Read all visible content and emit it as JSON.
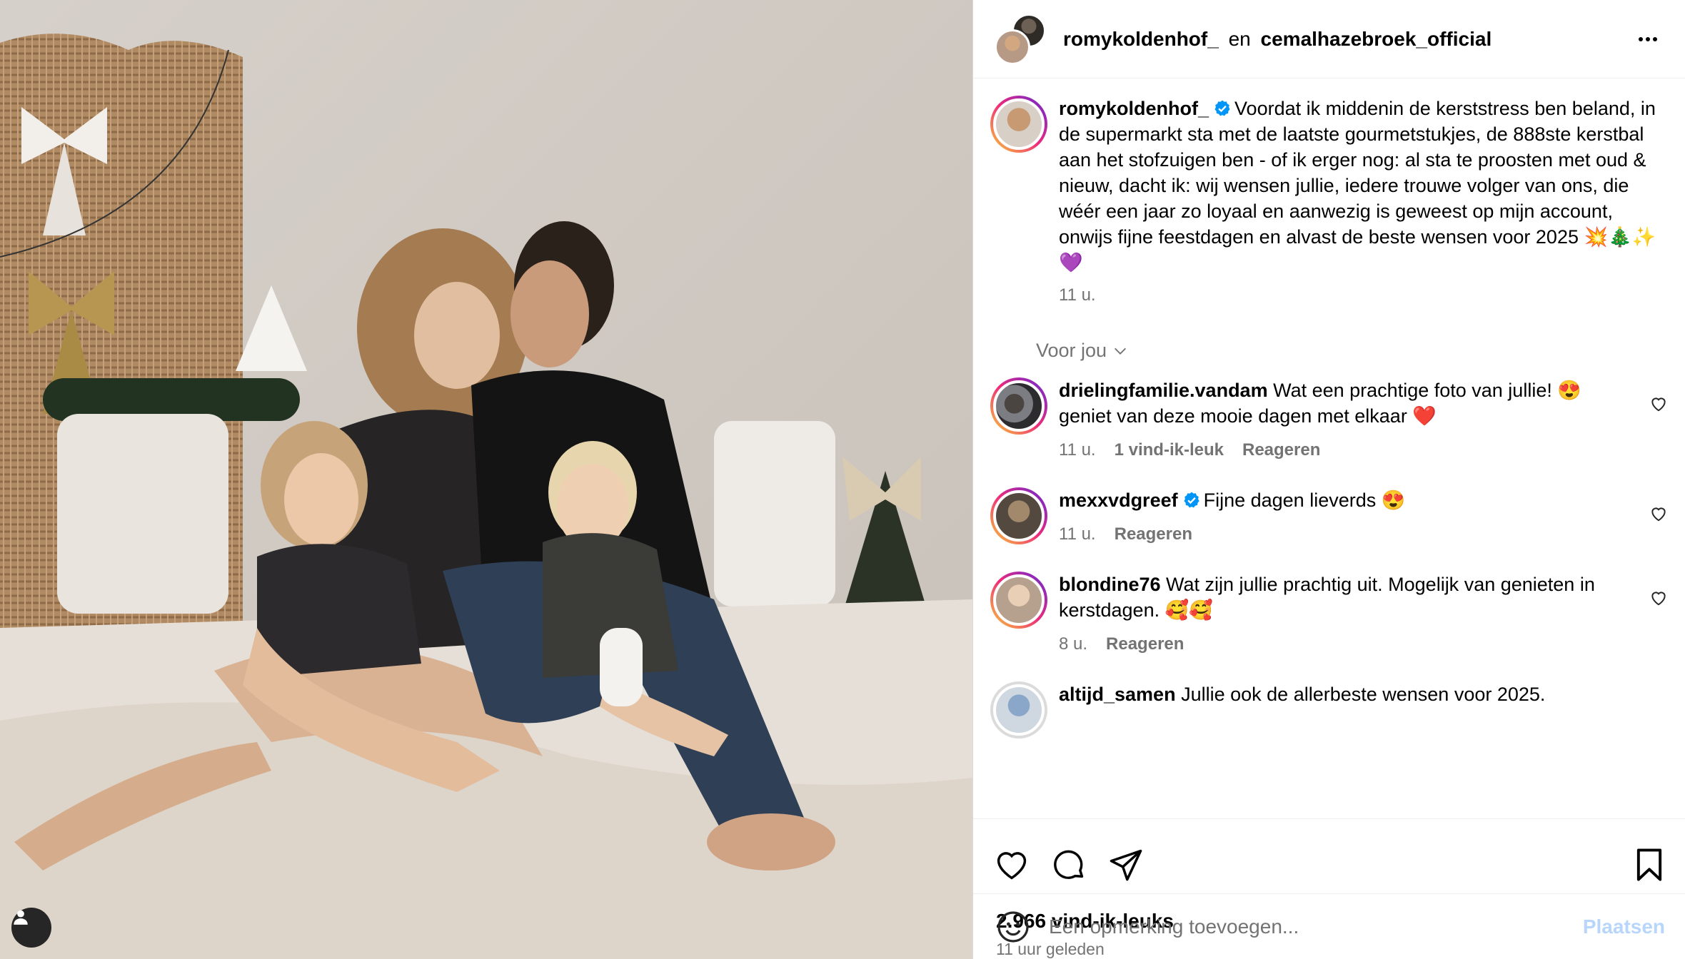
{
  "header": {
    "user1": "romykoldenhof_",
    "conjunction": "en",
    "user2": "cemalhazebroek_official"
  },
  "caption": {
    "username": "romykoldenhof_",
    "text": "Voordat ik middenin de kerststress ben beland, in de supermarkt sta met de laatste gourmetstukjes, de 888ste kerstbal aan het stofzuigen ben - of ik erger nog: al sta te proosten met oud & nieuw, dacht ik: wij wensen jullie, iedere trouwe volger van ons, die wéér een jaar zo loyaal en aanwezig is geweest op mijn account, onwijs fijne feestdagen en alvast de beste wensen voor 2025 💥🎄✨💜",
    "time": "11 u."
  },
  "for_you_label": "Voor jou",
  "comments": [
    {
      "username": "drielingfamilie.vandam",
      "text": "Wat een prachtige foto van jullie! 😍 geniet van deze mooie dagen met elkaar ❤️",
      "time": "11 u.",
      "likes": "1 vind-ik-leuk",
      "reply": "Reageren"
    },
    {
      "username": "mexxvdgreef",
      "text": "Fijne dagen lieverds 😍",
      "time": "11 u.",
      "reply": "Reageren"
    },
    {
      "username": "blondine76",
      "text": "Wat zijn jullie prachtig uit. Mogelijk van genieten in kerstdagen. 🥰🥰",
      "time": "8 u.",
      "reply": "Reageren"
    },
    {
      "username": "altijd_samen",
      "text": "Jullie ook de allerbeste wensen voor 2025."
    }
  ],
  "likes_count": "2.966 vind-ik-leuks",
  "posted_ago": "11 uur geleden",
  "add_comment": {
    "placeholder": "Een opmerking toevoegen...",
    "post_label": "Plaatsen"
  },
  "icons": [
    "more-icon",
    "verified-icon",
    "chevron-down-icon",
    "heart-icon",
    "comment-icon",
    "share-icon",
    "bookmark-icon",
    "emoji-icon",
    "user-tag-icon"
  ],
  "colors": {
    "verified": "#0095f6",
    "muted_text": "#737373",
    "post_disabled": "#b8d6fb"
  }
}
